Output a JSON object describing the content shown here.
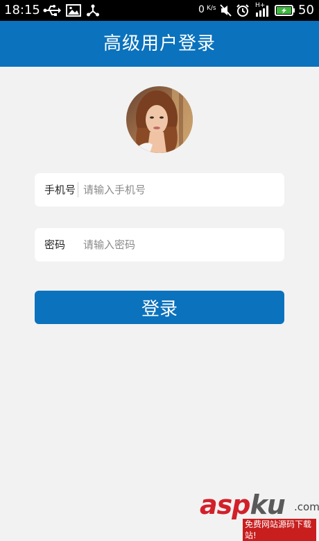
{
  "status_bar": {
    "time": "18:15",
    "net_speed": "0 K/s",
    "net_speed_value": "0",
    "net_speed_unit": "K/s",
    "network_type": "H+",
    "battery_level": "50",
    "icons": [
      "usb-icon",
      "image-icon",
      "share-icon",
      "mute-icon",
      "alarm-icon",
      "signal-icon",
      "battery-icon"
    ]
  },
  "header": {
    "title": "高级用户登录"
  },
  "form": {
    "phone_label": "手机号",
    "phone_placeholder": "请输入手机号",
    "password_label": "密码",
    "password_placeholder": "请输入密码",
    "login_label": "登录"
  },
  "watermark": {
    "brand": "aspku",
    "domain_suffix": ".com",
    "tagline": "免费网站源码下载站!"
  },
  "colors": {
    "primary": "#0b72bd",
    "background": "#f2f2f2",
    "watermark_red": "#c81e1e"
  }
}
